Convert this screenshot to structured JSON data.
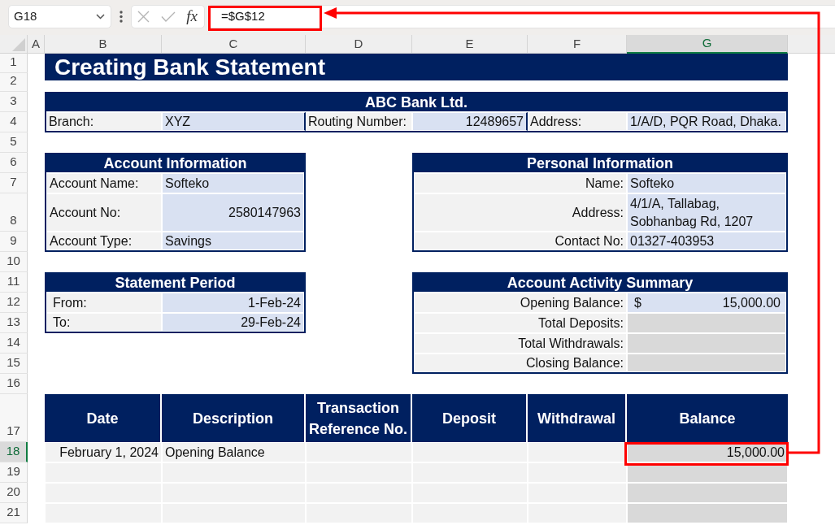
{
  "formula_bar": {
    "name_box": "G18",
    "function_button": "fx",
    "formula": "=$G$12"
  },
  "column_headers": [
    {
      "label": "A",
      "selected": false
    },
    {
      "label": "B",
      "selected": false
    },
    {
      "label": "C",
      "selected": false
    },
    {
      "label": "D",
      "selected": false
    },
    {
      "label": "E",
      "selected": false
    },
    {
      "label": "F",
      "selected": false
    },
    {
      "label": "G",
      "selected": true
    }
  ],
  "row_headers": [
    {
      "label": "1",
      "selected": false
    },
    {
      "label": "2",
      "selected": false
    },
    {
      "label": "3",
      "selected": false
    },
    {
      "label": "4",
      "selected": false
    },
    {
      "label": "5",
      "selected": false
    },
    {
      "label": "6",
      "selected": false
    },
    {
      "label": "7",
      "selected": false
    },
    {
      "label": "8",
      "selected": false
    },
    {
      "label": "9",
      "selected": false
    },
    {
      "label": "10",
      "selected": false
    },
    {
      "label": "11",
      "selected": false
    },
    {
      "label": "12",
      "selected": false
    },
    {
      "label": "13",
      "selected": false
    },
    {
      "label": "14",
      "selected": false
    },
    {
      "label": "15",
      "selected": false
    },
    {
      "label": "16",
      "selected": false
    },
    {
      "label": "17",
      "selected": false
    },
    {
      "label": "18",
      "selected": true
    },
    {
      "label": "19",
      "selected": false
    },
    {
      "label": "20",
      "selected": false
    },
    {
      "label": "21",
      "selected": false
    }
  ],
  "title": "Creating Bank Statement",
  "bank_details": {
    "title": "ABC Bank Ltd.",
    "fields": [
      {
        "label": "Branch:",
        "value": "XYZ",
        "kind": "text"
      },
      {
        "label": "Routing Number:",
        "value": "12489657",
        "kind": "number"
      },
      {
        "label": "Address:",
        "value": "1/A/D, PQR Road, Dhaka.",
        "kind": "text"
      }
    ]
  },
  "account_information": {
    "title": "Account Information",
    "rows": [
      {
        "label": "Account Name:",
        "value": "Softeko",
        "kind": "text"
      },
      {
        "label": "Account No:",
        "value": "2580147963",
        "kind": "number"
      },
      {
        "label": "Account Type:",
        "value": "Savings",
        "kind": "text"
      }
    ]
  },
  "personal_information": {
    "title": "Personal Information",
    "rows": [
      {
        "label": "Name:",
        "lines": [
          "Softeko"
        ]
      },
      {
        "label": "Address:",
        "lines": [
          "4/1/A, Tallabag,",
          "Sobhanbag Rd, 1207"
        ]
      },
      {
        "label": "Contact No:",
        "lines": [
          "01327-403953"
        ]
      }
    ]
  },
  "statement_period": {
    "title": "Statement Period",
    "rows": [
      {
        "label": "From:",
        "value": "1-Feb-24",
        "kind": "date"
      },
      {
        "label": "To:",
        "value": "29-Feb-24",
        "kind": "date"
      }
    ]
  },
  "account_activity_summary": {
    "title": "Account Activity Summary",
    "rows": [
      {
        "label": "Opening Balance:",
        "kind": "currency",
        "currency": "$",
        "value": "15,000.00"
      },
      {
        "label": "Total Deposits:",
        "kind": "formula"
      },
      {
        "label": "Total Withdrawals:",
        "kind": "formula"
      },
      {
        "label": "Closing Balance:",
        "kind": "formula"
      }
    ]
  },
  "transactions": {
    "columns": [
      "Date",
      "Description",
      "Transaction Reference No.",
      "Deposit",
      "Withdrawal",
      "Balance"
    ],
    "rows": [
      {
        "date": "February 1, 2024",
        "description": "Opening Balance",
        "balance": "15,000.00"
      }
    ]
  }
}
